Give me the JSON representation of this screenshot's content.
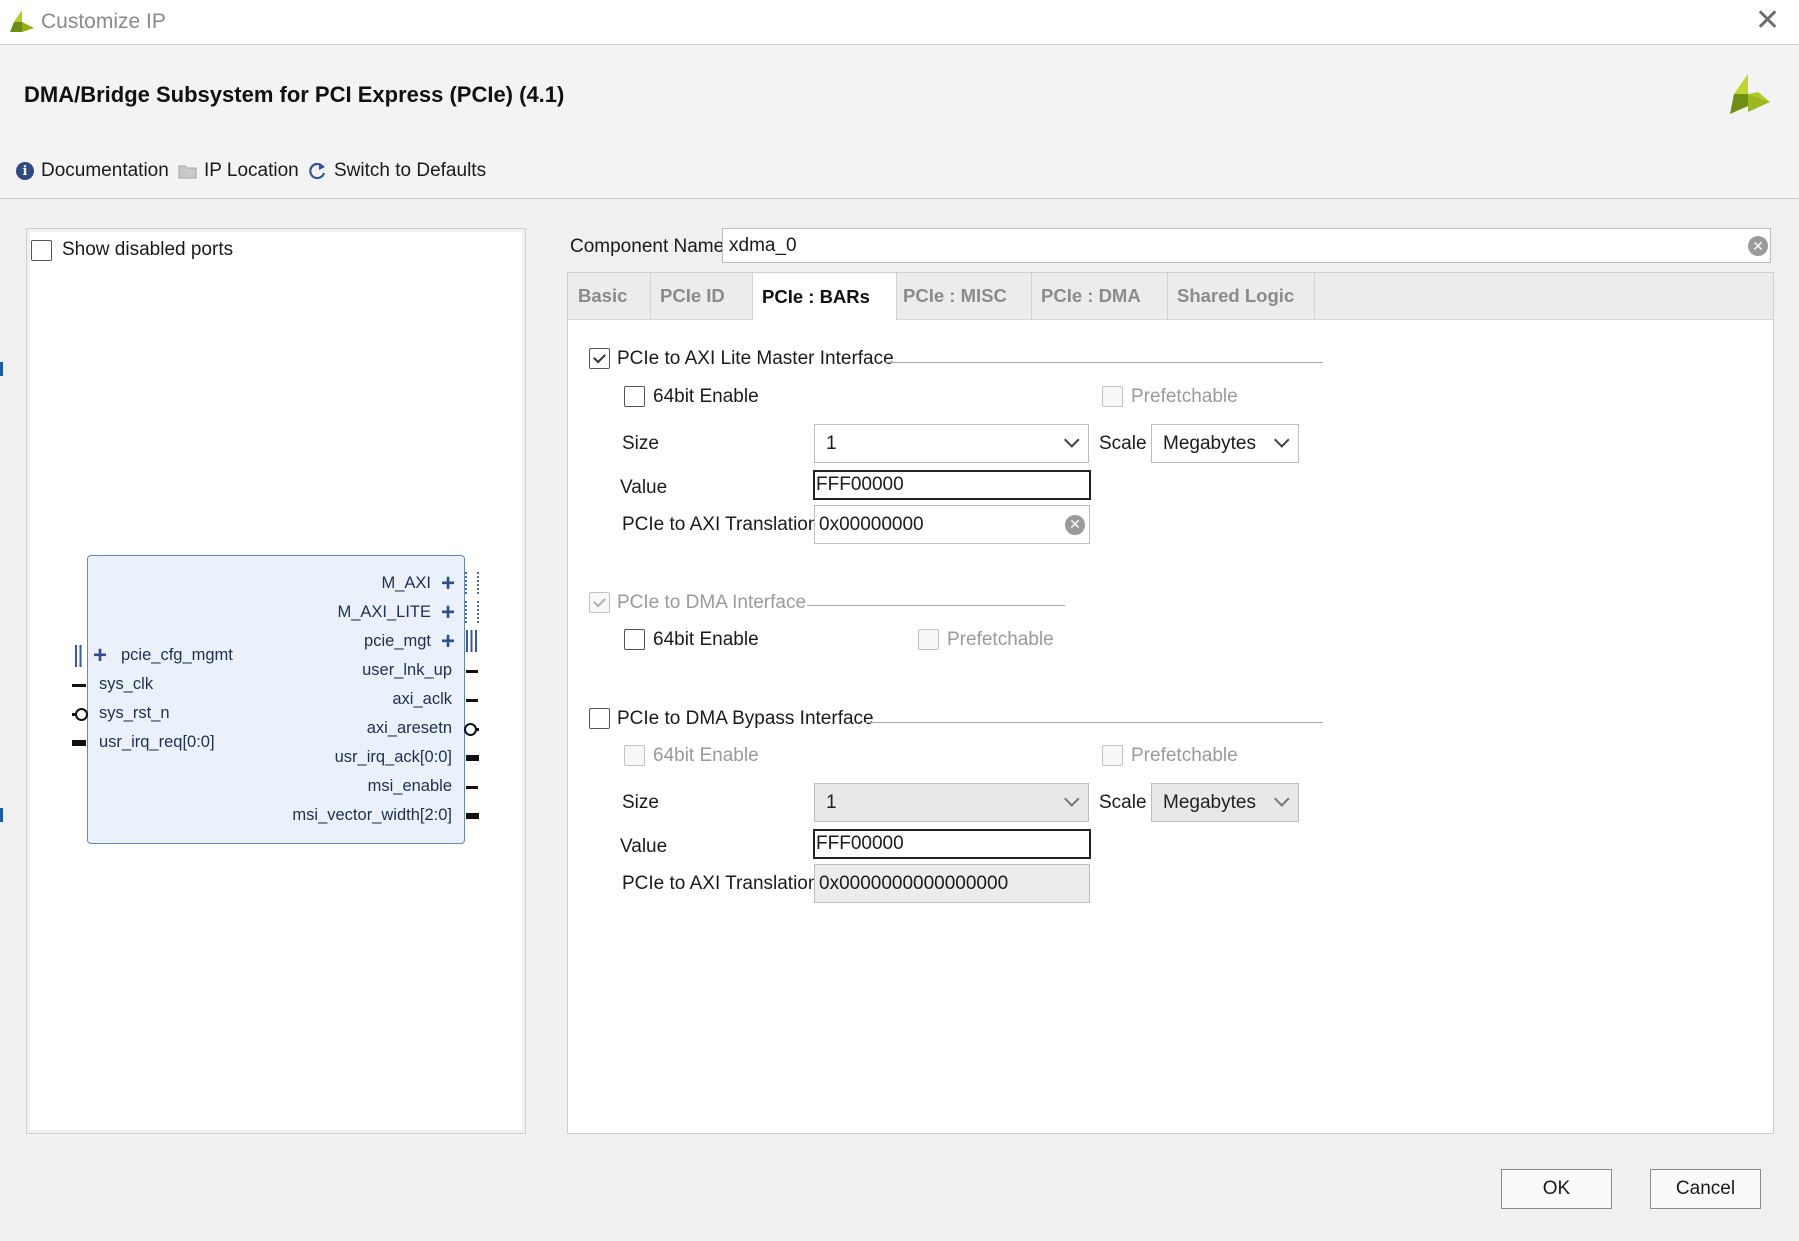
{
  "window": {
    "title": "Customize IP"
  },
  "header": {
    "title": "DMA/Bridge Subsystem for PCI Express (PCIe) (4.1)"
  },
  "toolbar": {
    "documentation": "Documentation",
    "ip_location": "IP Location",
    "switch_defaults": "Switch to Defaults"
  },
  "left_panel": {
    "show_disabled_ports": "Show disabled ports",
    "show_disabled_ports_checked": false,
    "block": {
      "right_ports": [
        "M_AXI",
        "M_AXI_LITE",
        "pcie_mgt",
        "user_lnk_up",
        "axi_aclk",
        "axi_aresetn",
        "usr_irq_ack[0:0]",
        "msi_enable",
        "msi_vector_width[2:0]"
      ],
      "left_ports": [
        "pcie_cfg_mgmt",
        "sys_clk",
        "sys_rst_n",
        "usr_irq_req[0:0]"
      ]
    }
  },
  "component": {
    "label": "Component Name",
    "value": "xdma_0"
  },
  "tabs": [
    "Basic",
    "PCIe ID",
    "PCIe : BARs",
    "PCIe : MISC",
    "PCIe : DMA",
    "Shared Logic"
  ],
  "active_tab": "PCIe : BARs",
  "bars": {
    "axi_lite": {
      "title": "PCIe to AXI Lite Master Interface",
      "checked": true,
      "enable64": "64bit Enable",
      "prefetchable": "Prefetchable",
      "size_label": "Size",
      "size_value": "1",
      "scale_label": "Scale",
      "scale_value": "Megabytes",
      "value_label": "Value",
      "value": "FFF00000",
      "translation_label": "PCIe to AXI Translation",
      "translation": "0x00000000"
    },
    "dma": {
      "title": "PCIe to DMA Interface",
      "checked": true,
      "enable64": "64bit Enable",
      "prefetchable": "Prefetchable"
    },
    "bypass": {
      "title": "PCIe to DMA Bypass Interface",
      "checked": false,
      "enable64": "64bit Enable",
      "prefetchable": "Prefetchable",
      "size_label": "Size",
      "size_value": "1",
      "scale_label": "Scale",
      "scale_value": "Megabytes",
      "value_label": "Value",
      "value": "FFF00000",
      "translation_label": "PCIe to AXI Translation",
      "translation": "0x0000000000000000"
    }
  },
  "buttons": {
    "ok": "OK",
    "cancel": "Cancel"
  },
  "colors": {
    "logo_green": "#9ab820",
    "logo_dark": "#6e8e14",
    "block_fill": "#eaf1fb",
    "block_border": "#6a86b8"
  }
}
